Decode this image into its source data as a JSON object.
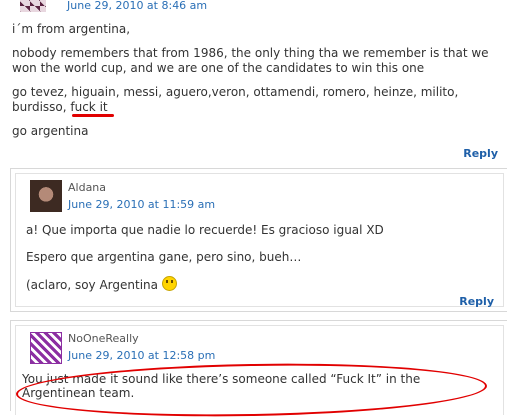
{
  "top_comment": {
    "date": "June 29, 2010 at 8:46 am",
    "line1": "i´m from argentina,",
    "line2": "nobody remembers that from 1986, the only thing tha we remember is that we won the world cup, and we are one of the candidates to win this one",
    "line3": "go tevez, higuain, messi, aguero,veron, ottamendi, romero, heinze, milito, burdisso, fuck it",
    "line4": "go argentina",
    "reply": "Reply"
  },
  "aldana_comment": {
    "name": "Aldana",
    "date": "June 29, 2010 at 11:59 am",
    "line1": "a! Que importa que nadie lo recuerde! Es gracioso igual XD",
    "line2": "Espero que argentina gane, pero sino, bueh…",
    "line3": "(aclaro, soy Argentina",
    "reply": "Reply"
  },
  "noone_comment": {
    "name": "NoOneReally",
    "date": "June 29, 2010 at 12:58 pm",
    "text": "You just made it sound like there’s someone called “Fuck It” in the Argentinean team."
  },
  "colors": {
    "link": "#2a6fb6",
    "highlight": "#e10000"
  },
  "icons": [
    "user-avatar-top",
    "aldana-avatar",
    "noonereally-avatar",
    "smiley-icon"
  ]
}
